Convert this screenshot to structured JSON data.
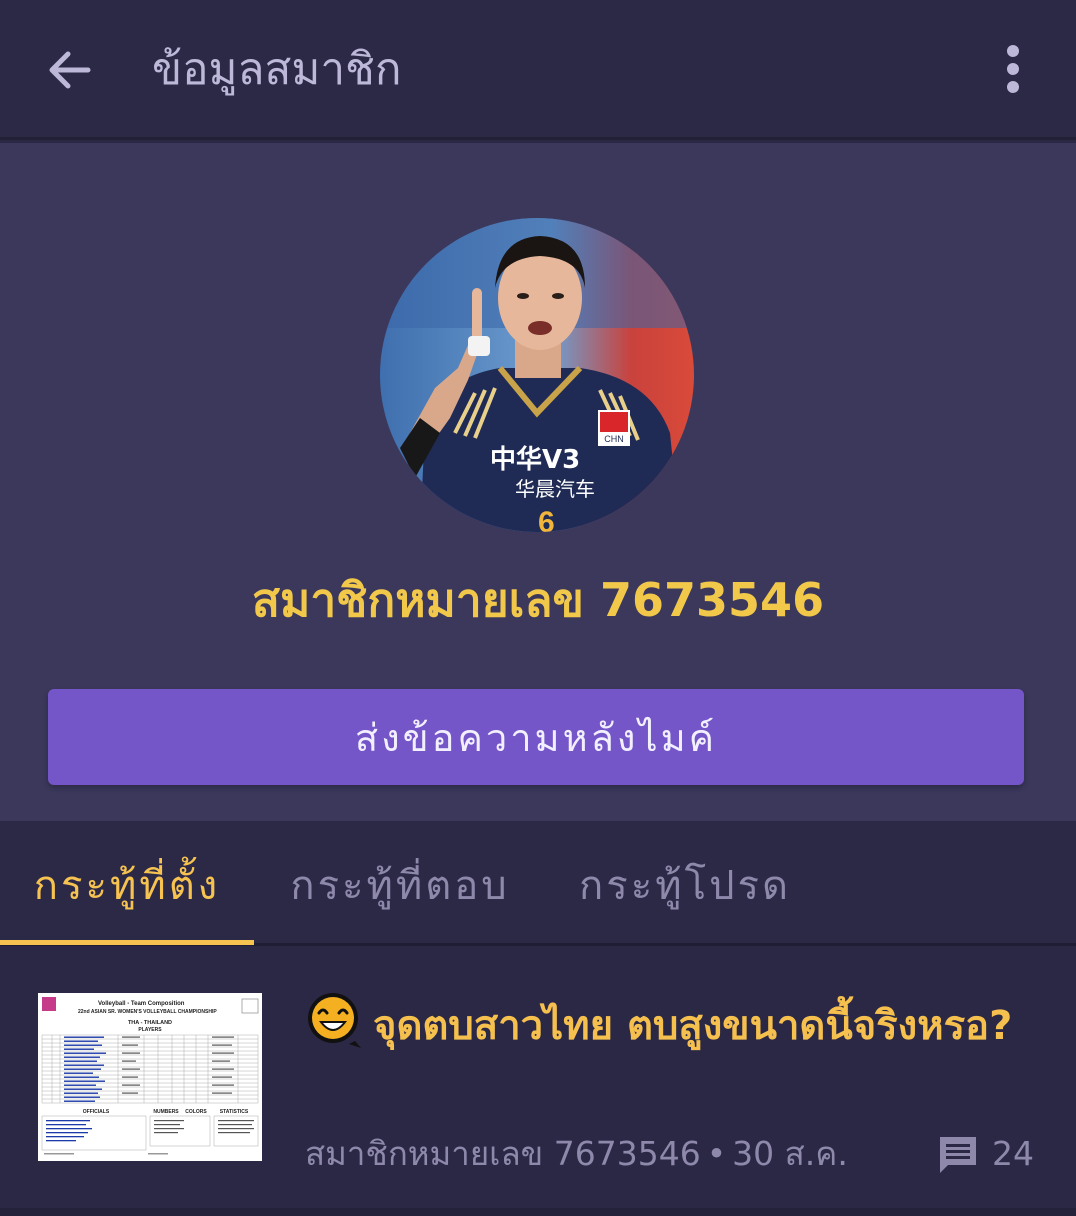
{
  "header": {
    "title": "ข้อมูลสมาชิก",
    "back_icon": "arrow-left-icon",
    "menu_icon": "more-vert-icon"
  },
  "profile": {
    "avatar_icon": "avatar",
    "member_label": "สมาชิกหมายเลข 7673546",
    "message_button": "ส่งข้อความหลังไมค์"
  },
  "tabs": [
    {
      "label": "กระทู้ที่ตั้ง",
      "active": true
    },
    {
      "label": "กระทู้ที่ตอบ",
      "active": false
    },
    {
      "label": "กระทู้โปรด",
      "active": false
    }
  ],
  "topics": [
    {
      "title": "จุดตบสาวไทย ตบสูงขนาดนี้จริงหรอ?",
      "author": "สมาชิกหมายเลข 7673546",
      "separator": "•",
      "date": "30 ส.ค.",
      "comment_count": "24",
      "emoji_icon": "laughing-emoji-icon",
      "thumbnail": {
        "header": "Volleyball - Team Composition",
        "event": "22nd ASIAN SR. WOMEN'S VOLLEYBALL CHAMPIONSHIP",
        "team": "THA - THAILAND",
        "section_players": "PLAYERS",
        "section_officials": "OFFICIALS",
        "section_numbers": "NUMBERS",
        "section_colors": "COLORS",
        "section_statistics": "STATISTICS"
      }
    }
  ],
  "colors": {
    "accent": "#f6c250",
    "button": "#7456c8",
    "background": "#2b2846",
    "profile_bg": "#3b385c"
  }
}
